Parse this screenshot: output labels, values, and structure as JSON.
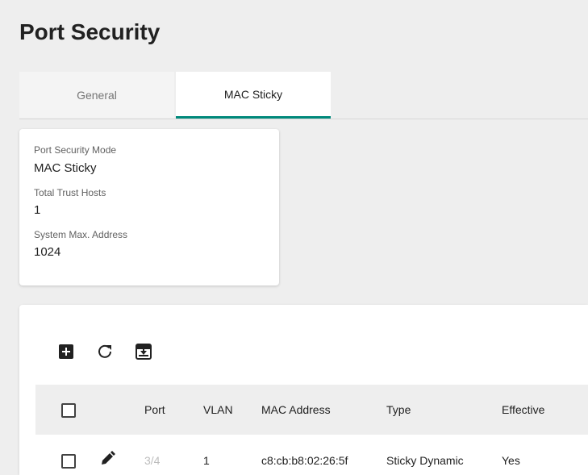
{
  "page": {
    "title": "Port Security"
  },
  "tabs": [
    {
      "label": "General",
      "active": false
    },
    {
      "label": "MAC Sticky",
      "active": true
    }
  ],
  "summary": {
    "mode_label": "Port Security Mode",
    "mode_value": "MAC Sticky",
    "hosts_label": "Total Trust Hosts",
    "hosts_value": "1",
    "max_label": "System Max. Address",
    "max_value": "1024"
  },
  "toolbar": {
    "icons": [
      "add-box-icon",
      "refresh-icon",
      "download-box-icon"
    ]
  },
  "table": {
    "columns": [
      "Port",
      "VLAN",
      "MAC Address",
      "Type",
      "Effective"
    ],
    "rows": [
      {
        "port": "3/4",
        "vlan": "1",
        "mac": "c8:cb:b8:02:26:5f",
        "type": "Sticky Dynamic",
        "effective": "Yes"
      }
    ]
  },
  "colors": {
    "accent": "#00897b",
    "background": "#eeeeee"
  }
}
